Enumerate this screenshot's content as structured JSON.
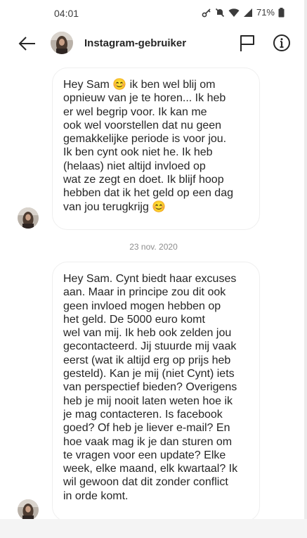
{
  "status_bar": {
    "time": "04:01",
    "battery": "71%",
    "icons": [
      "key-icon",
      "mute-icon",
      "wifi-icon",
      "signal-icon",
      "battery-icon"
    ]
  },
  "header": {
    "title": "Instagram-gebruiker",
    "icons": [
      "back-arrow-icon",
      "flag-icon",
      "info-icon"
    ]
  },
  "messages": [
    {
      "text": "Hey Sam 😊 ik ben wel blij om\nopnieuw van je te horen... Ik heb\ner wel begrip voor. Ik kan me\nook wel voorstellen dat nu geen\ngemakkelijke periode is voor jou.\nIk ben cynt ook niet he. Ik heb\n(helaas) niet altijd invloed op\nwat ze zegt en doet. Ik blijf hoop\nhebben dat ik het geld op een dag\nvan jou terugkrijg 😊"
    },
    {
      "text": "Hey Sam. Cynt biedt haar excuses\naan. Maar in principe zou dit ook\ngeen invloed mogen hebben op\nhet geld. De 5000 euro komt\nwel van mij. Ik heb ook zelden jou\ngecontacteerd. Jij stuurde mij vaak\neerst (wat ik altijd erg op prijs heb\ngesteld). Kan je mij (niet Cynt) iets\nvan perspectief bieden? Overigens\nheb je mij nooit laten weten hoe ik\nje mag contacteren. Is facebook\ngoed? Of heb je liever e-mail? En\nhoe vaak mag ik je dan sturen om\nte vragen voor een update? Elke\nweek, elke maand, elk kwartaal? Ik\nwil gewoon dat dit zonder conflict\nin orde komt."
    }
  ],
  "date_separator": "23 nov. 2020",
  "colors": {
    "text": "#262626",
    "secondary_text": "#8e8e8e",
    "bubble_border": "#efefef",
    "background": "#ffffff"
  }
}
